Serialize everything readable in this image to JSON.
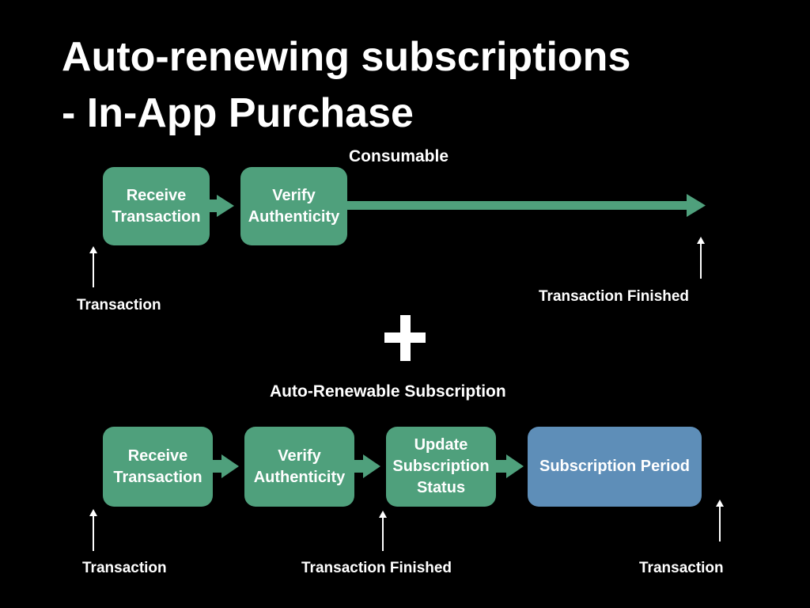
{
  "title": {
    "line1": "Auto-renewing subscriptions",
    "line2": "- In-App Purchase"
  },
  "consumable": {
    "label": "Consumable",
    "steps": [
      {
        "line1": "Receive",
        "line2": "Transaction"
      },
      {
        "line1": "Verify",
        "line2": "Authenticity"
      }
    ],
    "start_caption": "Transaction",
    "end_caption": "Transaction Finished"
  },
  "plus_symbol": "+",
  "subscription": {
    "label": "Auto-Renewable Subscription",
    "steps": [
      {
        "line1": "Receive",
        "line2": "Transaction"
      },
      {
        "line1": "Verify",
        "line2": "Authenticity"
      },
      {
        "line1": "Update",
        "line2": "Subscription",
        "line3": "Status"
      },
      {
        "line1": "Subscription Period"
      }
    ],
    "captions": {
      "start": "Transaction",
      "middle": "Transaction Finished",
      "end": "Transaction"
    }
  },
  "colors": {
    "background": "#000000",
    "green_box": "#4fa07c",
    "blue_box": "#5e8eb8",
    "arrow": "#4fa07c",
    "text": "#ffffff"
  }
}
